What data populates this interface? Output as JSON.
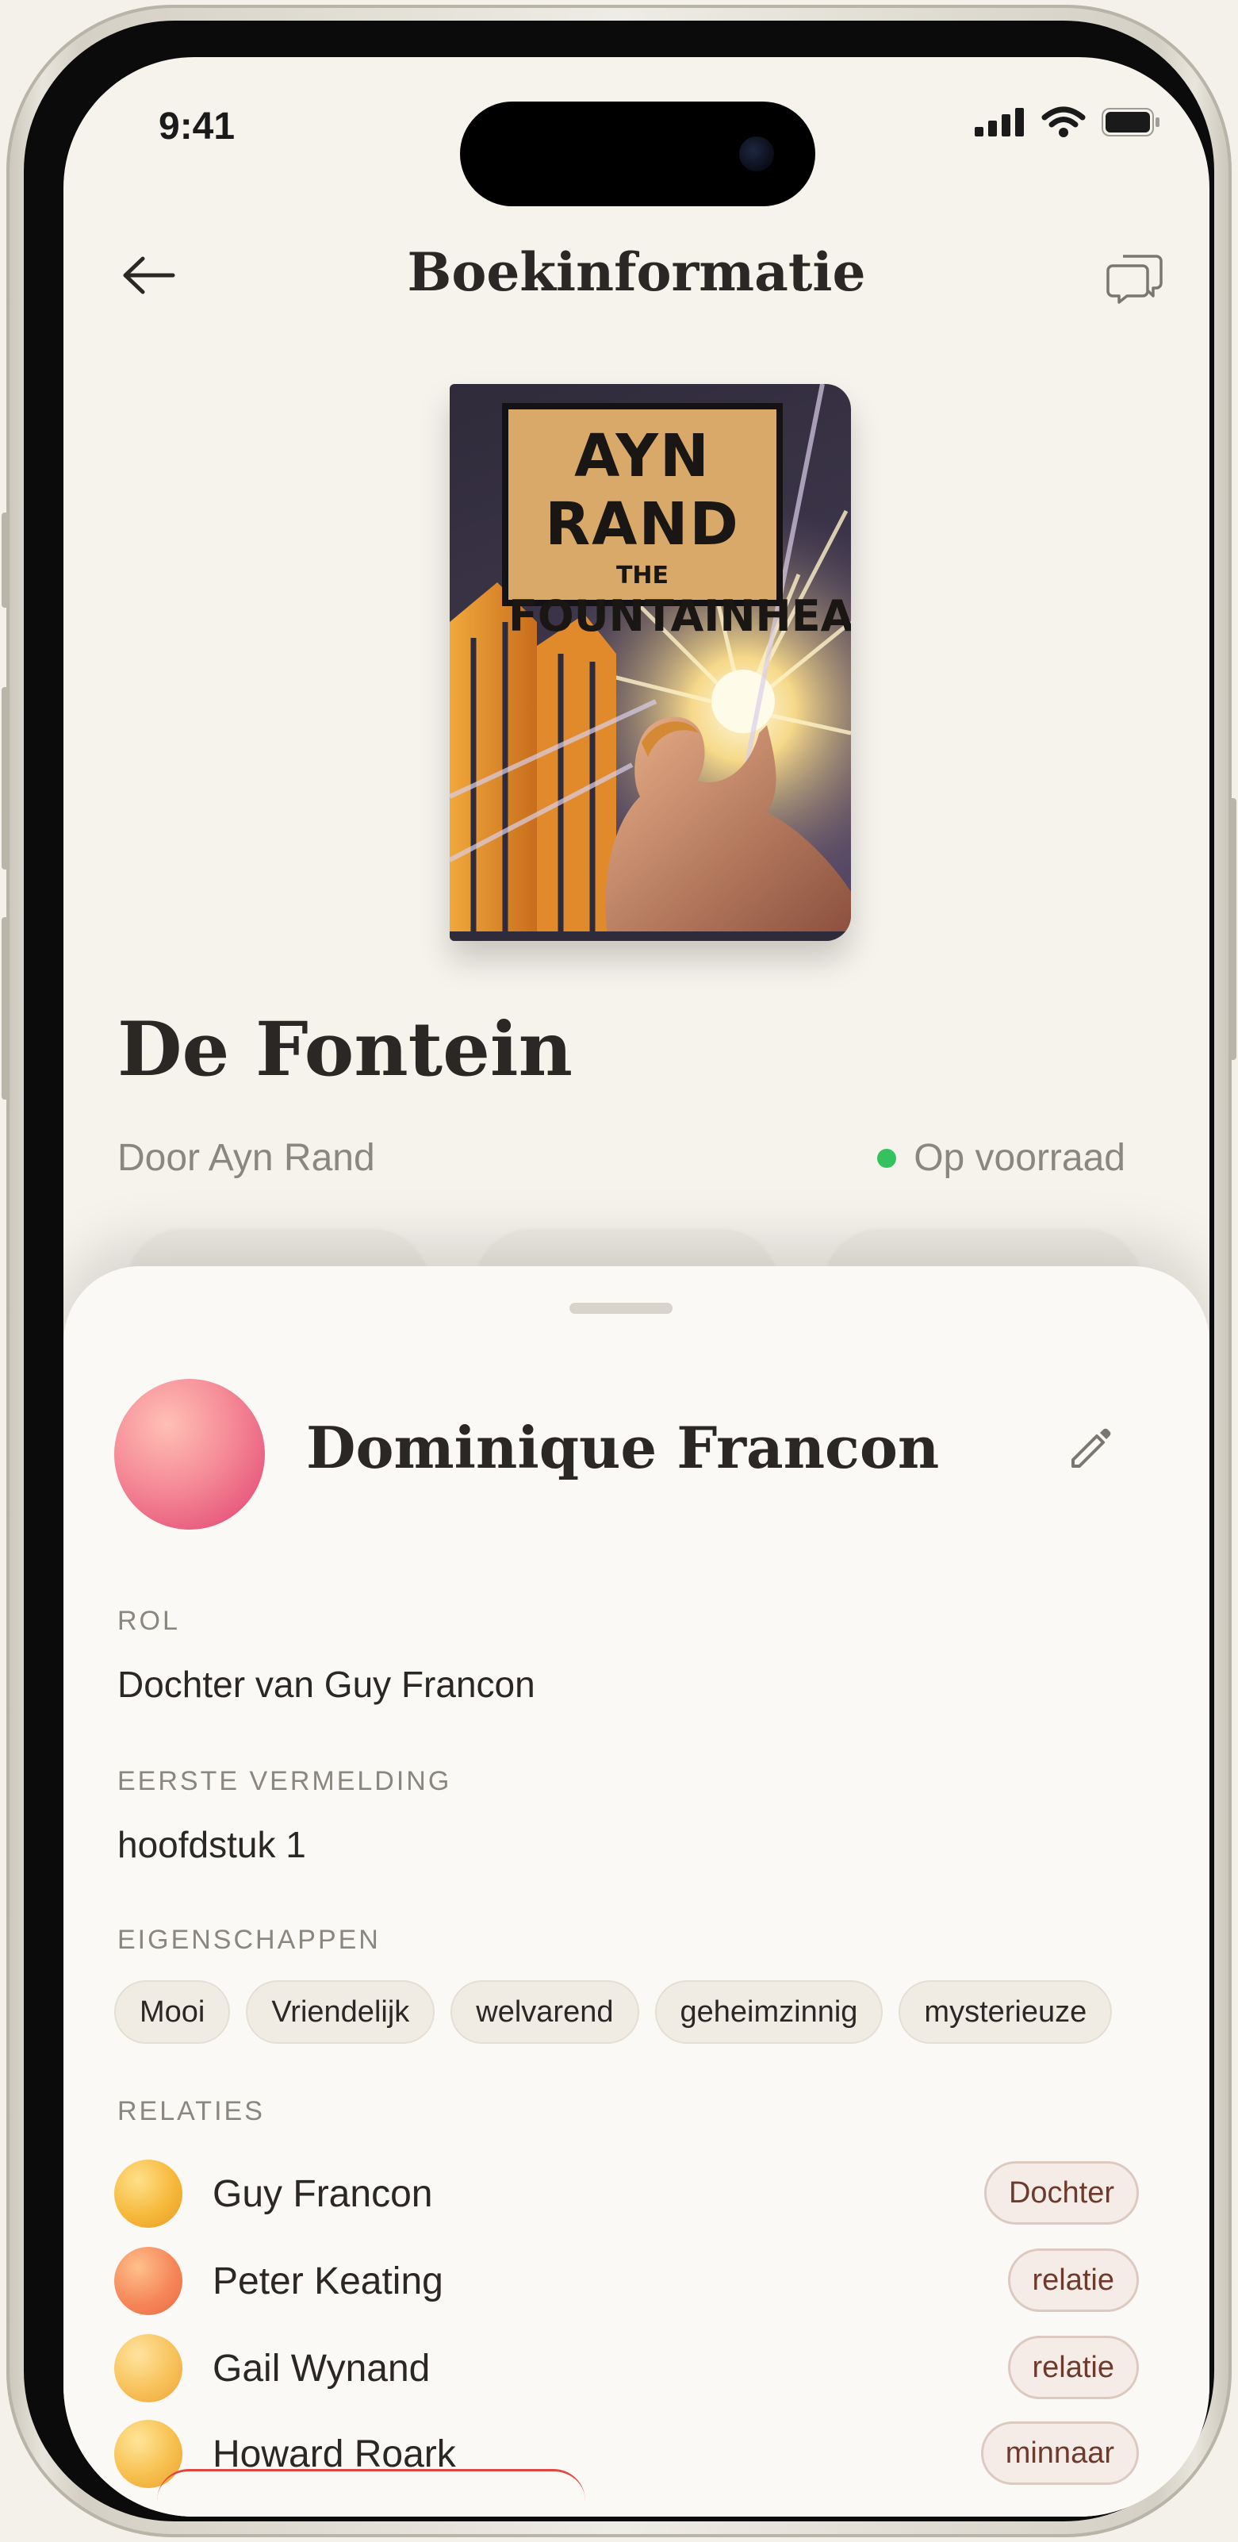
{
  "status_bar": {
    "time": "9:41"
  },
  "header": {
    "title": "Boekinformatie",
    "back_icon": "arrow-left-icon",
    "action_icon": "chat-bubbles-icon"
  },
  "cover": {
    "author_text": "AYN RAND",
    "the_text": "THE",
    "title_text": "FOUNTAINHEAD"
  },
  "book": {
    "title": "De Fontein",
    "author": "Door Ayn Rand",
    "stock": "Op voorraad",
    "stock_color": "#33c25d"
  },
  "character": {
    "name": "Dominique Francon",
    "edit_icon": "pencil-icon",
    "sections": {
      "role_label": "ROL",
      "role_value": "Dochter van Guy Francon",
      "first_label": "EERSTE VERMELDING",
      "first_value": "hoofdstuk 1",
      "traits_label": "EIGENSCHAPPEN",
      "relations_label": "RELATIES"
    },
    "traits": [
      "Mooi",
      "Vriendelijk",
      "welvarend",
      "geheimzinnig",
      "mysterieuze"
    ],
    "relations": [
      {
        "name": "Guy Francon",
        "relation": "Dochter"
      },
      {
        "name": "Peter Keating",
        "relation": "relatie"
      },
      {
        "name": "Gail Wynand",
        "relation": "relatie"
      },
      {
        "name": "Howard Roark",
        "relation": "minnaar"
      }
    ]
  },
  "colors": {
    "accent_badge_text": "#6d3a2e",
    "avatar": "#ef7a8e"
  }
}
